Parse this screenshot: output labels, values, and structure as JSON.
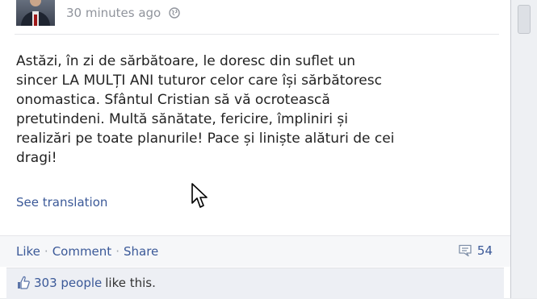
{
  "post": {
    "timestamp": "30 minutes ago",
    "privacy_icon": "globe-icon",
    "text": "Astăzi, în zi de sărbătoare, le doresc din suflet un\nsincer LA MULȚI ANI tuturor celor care își sărbătoresc\nonomastica. Sfântul Cristian să vă ocrotească\npretutindeni. Multă sănătate, fericire, împliniri și\nrealizări pe toate planurile! Pace și liniște alături de cei\ndragi!",
    "see_translation": "See translation"
  },
  "actions": {
    "like": "Like",
    "comment": "Comment",
    "share": "Share",
    "separator": "·",
    "comments_count": "54"
  },
  "likes": {
    "count_text": "303 people",
    "suffix": " like this."
  },
  "colors": {
    "link": "#3b5998",
    "meta": "#90949c",
    "actions_bg": "#f6f7f9",
    "likes_bg": "#edeff4"
  }
}
